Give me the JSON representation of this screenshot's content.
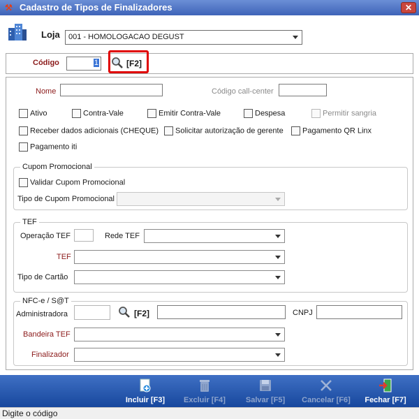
{
  "window": {
    "title": "Cadastro de Tipos de Finalizadores",
    "close_glyph": "✕"
  },
  "store": {
    "label": "Loja",
    "value": "001 - HOMOLOGACAO DEGUST"
  },
  "code": {
    "label": "Código",
    "value": "1",
    "shortcut": "[F2]"
  },
  "form": {
    "name_label": "Nome",
    "callcenter_label": "Código call-center",
    "checkboxes": {
      "ativo": "Ativo",
      "contra_vale": "Contra-Vale",
      "emitir_contra_vale": "Emitir Contra-Vale",
      "despesa": "Despesa",
      "permitir_sangria": "Permitir sangria",
      "receber_dados": "Receber dados adicionais (CHEQUE)",
      "solicitar_autorizacao": "Solicitar autorização de gerente",
      "pagamento_qr": "Pagamento QR Linx",
      "pagamento_iti": "Pagamento iti"
    }
  },
  "cupom": {
    "title": "Cupom Promocional",
    "validar_label": "Validar Cupom Promocional",
    "tipo_label": "Tipo de Cupom Promocional"
  },
  "tef": {
    "title": "TEF",
    "operacao_label": "Operação TEF",
    "rede_label": "Rede TEF",
    "tef_label": "TEF",
    "tipo_cartao_label": "Tipo de Cartão"
  },
  "nfce": {
    "title": "NFC-e / S@T",
    "administradora_label": "Administradora",
    "shortcut": "[F2]",
    "cnpj_label": "CNPJ",
    "bandeira_label": "Bandeira TEF",
    "finalizador_label": "Finalizador"
  },
  "toolbar": {
    "incluir": "Incluir [F3]",
    "excluir": "Excluir [F4]",
    "salvar": "Salvar [F5]",
    "cancelar": "Cancelar [F6]",
    "fechar": "Fechar [F7]"
  },
  "status": {
    "text": "Digite o código"
  },
  "colors": {
    "title_bar": "#3e63b8",
    "toolbar": "#17479d",
    "required_label": "#8b1a1a",
    "highlight": "#e00000"
  }
}
